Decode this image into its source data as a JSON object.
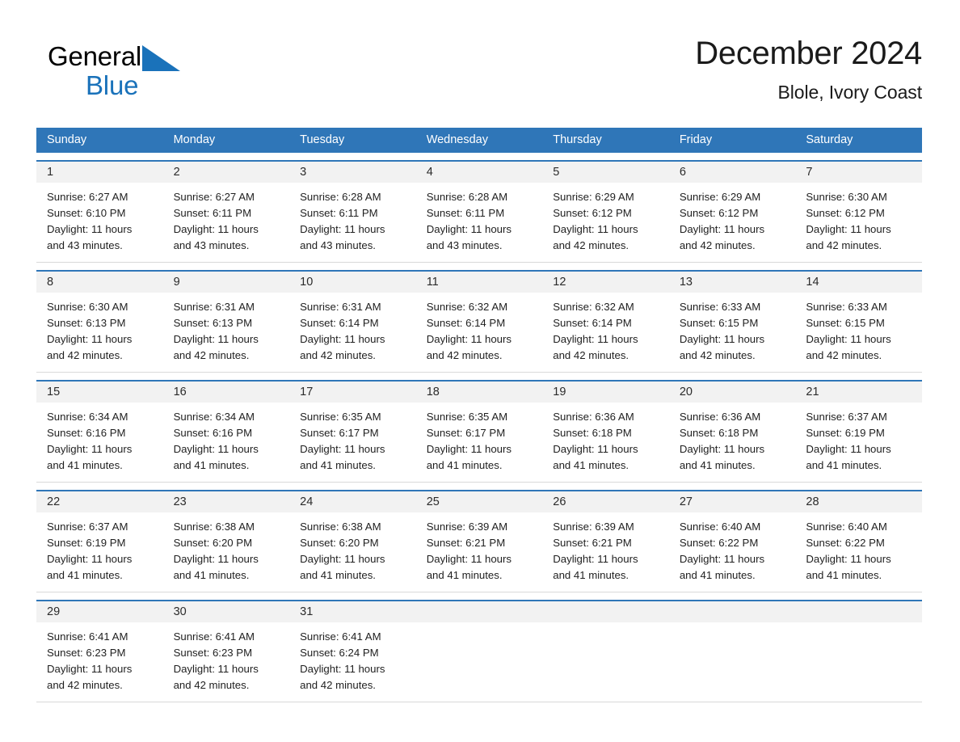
{
  "brand": {
    "name_part1": "General",
    "name_part2": "Blue",
    "triangle_color": "#1a72ba",
    "text_color": "#000000"
  },
  "header": {
    "title": "December 2024",
    "subtitle": "Blole, Ivory Coast"
  },
  "colors": {
    "header_blue": "#2f76b8",
    "date_band_gray": "#f2f2f2",
    "row_divider": "#d9d9d9",
    "text": "#1f1f1f"
  },
  "day_names": [
    "Sunday",
    "Monday",
    "Tuesday",
    "Wednesday",
    "Thursday",
    "Friday",
    "Saturday"
  ],
  "weeks": [
    {
      "dates": [
        "1",
        "2",
        "3",
        "4",
        "5",
        "6",
        "7"
      ],
      "cells": [
        {
          "sunrise": "Sunrise: 6:27 AM",
          "sunset": "Sunset: 6:10 PM",
          "daylight1": "Daylight: 11 hours",
          "daylight2": "and 43 minutes."
        },
        {
          "sunrise": "Sunrise: 6:27 AM",
          "sunset": "Sunset: 6:11 PM",
          "daylight1": "Daylight: 11 hours",
          "daylight2": "and 43 minutes."
        },
        {
          "sunrise": "Sunrise: 6:28 AM",
          "sunset": "Sunset: 6:11 PM",
          "daylight1": "Daylight: 11 hours",
          "daylight2": "and 43 minutes."
        },
        {
          "sunrise": "Sunrise: 6:28 AM",
          "sunset": "Sunset: 6:11 PM",
          "daylight1": "Daylight: 11 hours",
          "daylight2": "and 43 minutes."
        },
        {
          "sunrise": "Sunrise: 6:29 AM",
          "sunset": "Sunset: 6:12 PM",
          "daylight1": "Daylight: 11 hours",
          "daylight2": "and 42 minutes."
        },
        {
          "sunrise": "Sunrise: 6:29 AM",
          "sunset": "Sunset: 6:12 PM",
          "daylight1": "Daylight: 11 hours",
          "daylight2": "and 42 minutes."
        },
        {
          "sunrise": "Sunrise: 6:30 AM",
          "sunset": "Sunset: 6:12 PM",
          "daylight1": "Daylight: 11 hours",
          "daylight2": "and 42 minutes."
        }
      ]
    },
    {
      "dates": [
        "8",
        "9",
        "10",
        "11",
        "12",
        "13",
        "14"
      ],
      "cells": [
        {
          "sunrise": "Sunrise: 6:30 AM",
          "sunset": "Sunset: 6:13 PM",
          "daylight1": "Daylight: 11 hours",
          "daylight2": "and 42 minutes."
        },
        {
          "sunrise": "Sunrise: 6:31 AM",
          "sunset": "Sunset: 6:13 PM",
          "daylight1": "Daylight: 11 hours",
          "daylight2": "and 42 minutes."
        },
        {
          "sunrise": "Sunrise: 6:31 AM",
          "sunset": "Sunset: 6:14 PM",
          "daylight1": "Daylight: 11 hours",
          "daylight2": "and 42 minutes."
        },
        {
          "sunrise": "Sunrise: 6:32 AM",
          "sunset": "Sunset: 6:14 PM",
          "daylight1": "Daylight: 11 hours",
          "daylight2": "and 42 minutes."
        },
        {
          "sunrise": "Sunrise: 6:32 AM",
          "sunset": "Sunset: 6:14 PM",
          "daylight1": "Daylight: 11 hours",
          "daylight2": "and 42 minutes."
        },
        {
          "sunrise": "Sunrise: 6:33 AM",
          "sunset": "Sunset: 6:15 PM",
          "daylight1": "Daylight: 11 hours",
          "daylight2": "and 42 minutes."
        },
        {
          "sunrise": "Sunrise: 6:33 AM",
          "sunset": "Sunset: 6:15 PM",
          "daylight1": "Daylight: 11 hours",
          "daylight2": "and 42 minutes."
        }
      ]
    },
    {
      "dates": [
        "15",
        "16",
        "17",
        "18",
        "19",
        "20",
        "21"
      ],
      "cells": [
        {
          "sunrise": "Sunrise: 6:34 AM",
          "sunset": "Sunset: 6:16 PM",
          "daylight1": "Daylight: 11 hours",
          "daylight2": "and 41 minutes."
        },
        {
          "sunrise": "Sunrise: 6:34 AM",
          "sunset": "Sunset: 6:16 PM",
          "daylight1": "Daylight: 11 hours",
          "daylight2": "and 41 minutes."
        },
        {
          "sunrise": "Sunrise: 6:35 AM",
          "sunset": "Sunset: 6:17 PM",
          "daylight1": "Daylight: 11 hours",
          "daylight2": "and 41 minutes."
        },
        {
          "sunrise": "Sunrise: 6:35 AM",
          "sunset": "Sunset: 6:17 PM",
          "daylight1": "Daylight: 11 hours",
          "daylight2": "and 41 minutes."
        },
        {
          "sunrise": "Sunrise: 6:36 AM",
          "sunset": "Sunset: 6:18 PM",
          "daylight1": "Daylight: 11 hours",
          "daylight2": "and 41 minutes."
        },
        {
          "sunrise": "Sunrise: 6:36 AM",
          "sunset": "Sunset: 6:18 PM",
          "daylight1": "Daylight: 11 hours",
          "daylight2": "and 41 minutes."
        },
        {
          "sunrise": "Sunrise: 6:37 AM",
          "sunset": "Sunset: 6:19 PM",
          "daylight1": "Daylight: 11 hours",
          "daylight2": "and 41 minutes."
        }
      ]
    },
    {
      "dates": [
        "22",
        "23",
        "24",
        "25",
        "26",
        "27",
        "28"
      ],
      "cells": [
        {
          "sunrise": "Sunrise: 6:37 AM",
          "sunset": "Sunset: 6:19 PM",
          "daylight1": "Daylight: 11 hours",
          "daylight2": "and 41 minutes."
        },
        {
          "sunrise": "Sunrise: 6:38 AM",
          "sunset": "Sunset: 6:20 PM",
          "daylight1": "Daylight: 11 hours",
          "daylight2": "and 41 minutes."
        },
        {
          "sunrise": "Sunrise: 6:38 AM",
          "sunset": "Sunset: 6:20 PM",
          "daylight1": "Daylight: 11 hours",
          "daylight2": "and 41 minutes."
        },
        {
          "sunrise": "Sunrise: 6:39 AM",
          "sunset": "Sunset: 6:21 PM",
          "daylight1": "Daylight: 11 hours",
          "daylight2": "and 41 minutes."
        },
        {
          "sunrise": "Sunrise: 6:39 AM",
          "sunset": "Sunset: 6:21 PM",
          "daylight1": "Daylight: 11 hours",
          "daylight2": "and 41 minutes."
        },
        {
          "sunrise": "Sunrise: 6:40 AM",
          "sunset": "Sunset: 6:22 PM",
          "daylight1": "Daylight: 11 hours",
          "daylight2": "and 41 minutes."
        },
        {
          "sunrise": "Sunrise: 6:40 AM",
          "sunset": "Sunset: 6:22 PM",
          "daylight1": "Daylight: 11 hours",
          "daylight2": "and 41 minutes."
        }
      ]
    },
    {
      "dates": [
        "29",
        "30",
        "31",
        "",
        "",
        "",
        ""
      ],
      "cells": [
        {
          "sunrise": "Sunrise: 6:41 AM",
          "sunset": "Sunset: 6:23 PM",
          "daylight1": "Daylight: 11 hours",
          "daylight2": "and 42 minutes."
        },
        {
          "sunrise": "Sunrise: 6:41 AM",
          "sunset": "Sunset: 6:23 PM",
          "daylight1": "Daylight: 11 hours",
          "daylight2": "and 42 minutes."
        },
        {
          "sunrise": "Sunrise: 6:41 AM",
          "sunset": "Sunset: 6:24 PM",
          "daylight1": "Daylight: 11 hours",
          "daylight2": "and 42 minutes."
        },
        {
          "sunrise": "",
          "sunset": "",
          "daylight1": "",
          "daylight2": ""
        },
        {
          "sunrise": "",
          "sunset": "",
          "daylight1": "",
          "daylight2": ""
        },
        {
          "sunrise": "",
          "sunset": "",
          "daylight1": "",
          "daylight2": ""
        },
        {
          "sunrise": "",
          "sunset": "",
          "daylight1": "",
          "daylight2": ""
        }
      ]
    }
  ]
}
